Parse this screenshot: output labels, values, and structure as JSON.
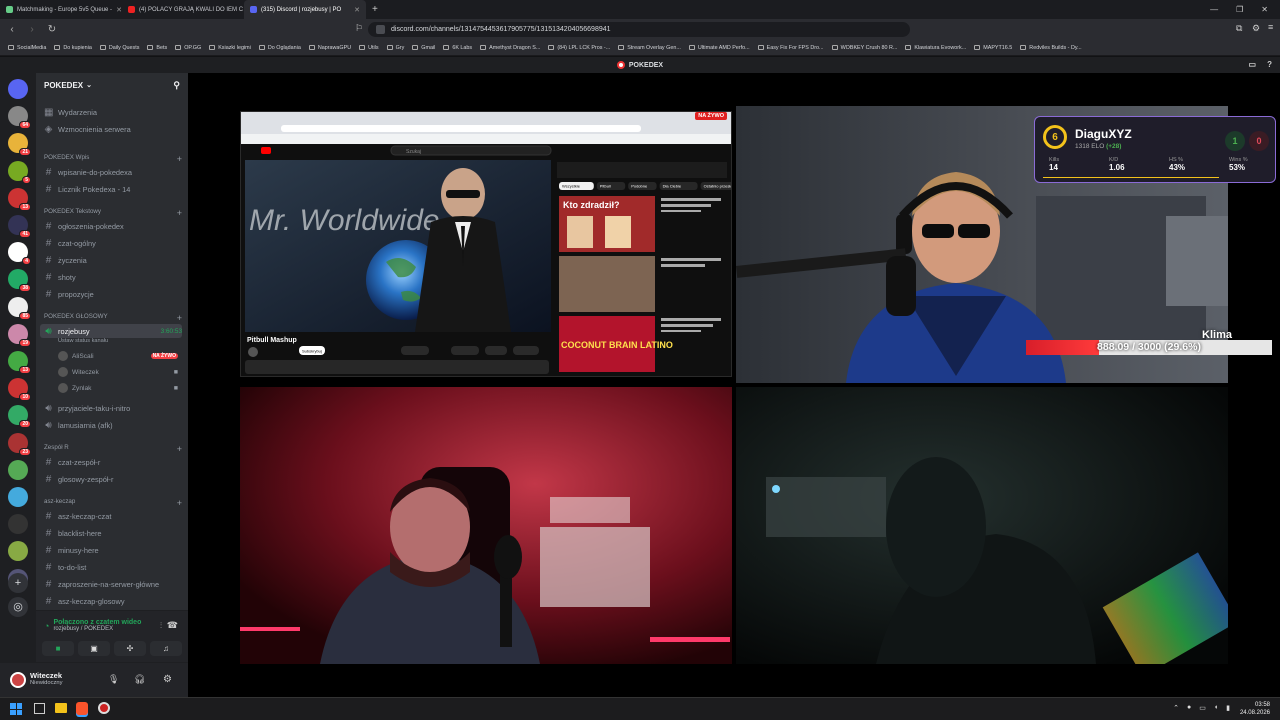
{
  "tabs": [
    {
      "label": "Matchmaking - Europe 5v5 Queue -",
      "color": "#6c8"
    },
    {
      "label": "(4) POLACY GRAJĄ KWALI DO IEM C",
      "color": "#e22"
    },
    {
      "label": "(315) Discord | rozjebusy | PO",
      "color": "#5865f2"
    }
  ],
  "url": "discord.com/channels/1314754453617905775/1315134204056698941",
  "bookmarks": [
    "SocialMedia",
    "Do kupienia",
    "Daily Quests",
    "Bets",
    "OP.GG",
    "Ksiazki legimi",
    "Do Oglądania",
    "NaprawaGPU",
    "Utils",
    "Gry",
    "Gmail",
    "6K Labs",
    "Amethyst Dragon S...",
    "(84) LPL LCK Pros -...",
    "Stream Overlay Gen...",
    "Ultimate AMD Perfo...",
    "Easy Fix For FPS Dro...",
    "WOBKEY Crush 80 R...",
    "Klawiatura Evowork...",
    "MAPYT16.5",
    "Redviles Builds - Dy..."
  ],
  "discord_title": "POKEDEX",
  "server": {
    "name": "POKEDEX",
    "top_items": [
      "Wydarzenia",
      "Wzmocnienia serwera"
    ],
    "categories": {
      "wpis": "POKEDEX Wpis",
      "tekstowy": "POKEDEX Tekstowy",
      "glosowy": "POKEDEX GŁOSOWY",
      "zespol": "Zespół R",
      "asz": "asz-keczap"
    },
    "channels_wpis": [
      "wpisanie-do-pokedexa",
      "Licznik Pokedexa - 14"
    ],
    "channels_tekst": [
      "ogłoszenia-pokedex",
      "czat-ogólny",
      "życzenia",
      "shoty",
      "propozycje"
    ],
    "voice_active": {
      "name": "rozjebusy",
      "timer": "3:60:53",
      "status": "Ustaw status kanału"
    },
    "voice_users": [
      {
        "name": "AliScali",
        "live": "NA ŻYWO"
      },
      {
        "name": "Witeczek"
      },
      {
        "name": "Zynlak"
      }
    ],
    "channels_voice_other": [
      "przyjaciele-taku-i-nitro",
      "lamusiarnia (afk)"
    ],
    "channels_zespol": [
      "czat-zespół-r",
      "glosowy-zespół-r"
    ],
    "channels_asz": [
      "asz-keczap-czat",
      "blacklist-here",
      "minusy-here",
      "to-do-list",
      "zaproszenie-na-serwer-główne",
      "asz-keczap-glosowy"
    ]
  },
  "rail_badges": [
    "64",
    "21",
    "5",
    "13",
    "41",
    "4",
    "38",
    "85",
    "19",
    "13",
    "10",
    "20",
    "23"
  ],
  "voice_panel": {
    "status": "Połączono z czatem wideo",
    "location": "rozjebusy / POKEDEX"
  },
  "user": {
    "name": "Witeczek",
    "status": "Niewidoczny"
  },
  "youtube": {
    "live": "NA ŻYWO",
    "video_title": "Pitbull Mashup",
    "title_overlay": "Mr. Worldwide",
    "subscribe": "Subskrybuj",
    "side_thumb_1": "Kto zdradził?",
    "side_thumb_2": "COCONUT BRAIN LATINO",
    "search": "Szukaj",
    "chips": [
      "Wszystkie",
      "Pitbull",
      "Podobne",
      "Dla Ciebie",
      "Ostatnio przesłane",
      "Obejrzane"
    ]
  },
  "overlay": {
    "rank": "6",
    "player": "DiaguXYZ",
    "elo": "1318 ELO",
    "elo_change": "(+28)",
    "score": [
      "1",
      "0"
    ],
    "stats": [
      {
        "label": "Kills",
        "value": "14"
      },
      {
        "label": "K/D",
        "value": "1.06"
      },
      {
        "label": "HS %",
        "value": "43%"
      },
      {
        "label": "Wins %",
        "value": "53%"
      }
    ]
  },
  "bar": {
    "name": "Klima",
    "text": "888.09 / 3000 (29.6%)",
    "fraction": 0.296
  },
  "clock": {
    "time": "03:58",
    "date": "24.08.2026"
  }
}
